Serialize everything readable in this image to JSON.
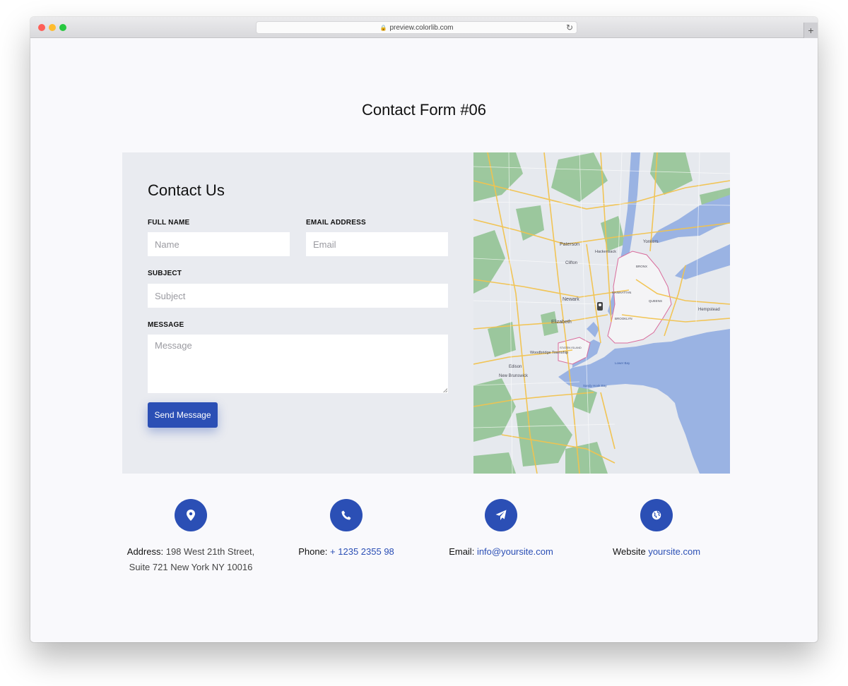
{
  "browser": {
    "url": "preview.colorlib.com",
    "lock_icon": "lock-icon",
    "reload_icon": "reload-icon",
    "new_tab_label": "+"
  },
  "page": {
    "title": "Contact Form #06"
  },
  "form": {
    "heading": "Contact Us",
    "full_name_label": "FULL NAME",
    "full_name_placeholder": "Name",
    "email_label": "EMAIL ADDRESS",
    "email_placeholder": "Email",
    "subject_label": "SUBJECT",
    "subject_placeholder": "Subject",
    "message_label": "MESSAGE",
    "message_placeholder": "Message",
    "submit_label": "Send Message"
  },
  "map": {
    "labels": {
      "paterson": "Paterson",
      "newark": "Newark",
      "elizabeth": "Elizabeth",
      "manhattan": "MANHATTAN",
      "brooklyn": "BROOKLYN",
      "queens": "QUEENS",
      "bronx": "BRONX",
      "yonkers": "Yonkers",
      "hempstead": "Hempstead",
      "new_brunswick": "New Brunswick",
      "staten_island": "STATEN ISLAND",
      "edison": "Edison",
      "woodbridge": "Woodbridge Township",
      "clifton": "Clifton",
      "hackensack": "Hackensack",
      "sandy_hook_bay": "Sandy Hook Bay",
      "lower_bay": "Lower Bay"
    }
  },
  "info": {
    "address": {
      "icon": "map-pin-icon",
      "label": "Address:",
      "line1": "198 West 21th Street,",
      "line2": "Suite 721 New York NY 10016"
    },
    "phone": {
      "icon": "phone-icon",
      "label": "Phone:",
      "value": "+ 1235 2355 98"
    },
    "email": {
      "icon": "paper-plane-icon",
      "label": "Email:",
      "value": "info@yoursite.com"
    },
    "website": {
      "icon": "globe-icon",
      "label": "Website",
      "value": "yoursite.com"
    }
  },
  "colors": {
    "accent": "#2b4fb5",
    "panel": "#e9ebf0",
    "page_bg": "#f9f9fc",
    "map_water": "#9ab3e3",
    "map_land": "#e6e9ee",
    "map_park": "#8fc28f",
    "map_road": "#f2c34e"
  }
}
